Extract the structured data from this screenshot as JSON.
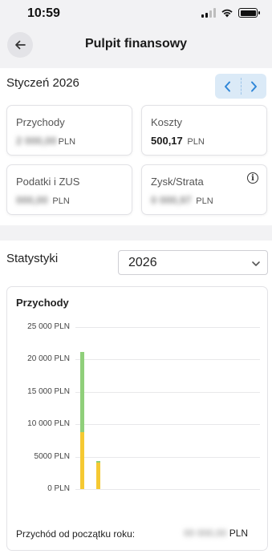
{
  "status_bar": {
    "time": "10:59"
  },
  "header": {
    "title": "Pulpit finansowy"
  },
  "month": {
    "label": "Styczeń 2026",
    "prev": "‹",
    "next": "›"
  },
  "tiles": {
    "income": {
      "label": "Przychody",
      "value": "2 000,00",
      "unit": "PLN"
    },
    "costs": {
      "label": "Koszty",
      "value": "500,17",
      "unit": "PLN"
    },
    "taxes": {
      "label": "Podatki i ZUS",
      "value": "000,00",
      "unit": "PLN"
    },
    "profit": {
      "label": "Zysk/Strata",
      "value": "0 000,97",
      "unit": "PLN",
      "info": "i"
    }
  },
  "stats": {
    "label": "Statystyki",
    "year_selected": "2026"
  },
  "chart_data": {
    "type": "bar",
    "title": "Przychody",
    "y_ticks": [
      "25 000 PLN",
      "20 000 PLN",
      "15 000 PLN",
      "10 000 PLN",
      "5000 PLN",
      "0 PLN"
    ],
    "ylim": [
      0,
      25000
    ],
    "series": [
      {
        "color": "#f5c932",
        "values": [
          8800,
          4100
        ]
      },
      {
        "color": "#8fcf7a",
        "values": [
          12400,
          250
        ]
      }
    ],
    "grid": true
  },
  "ytd": {
    "label": "Przychód od początku roku:",
    "value": "00 000,00",
    "unit": "PLN"
  }
}
